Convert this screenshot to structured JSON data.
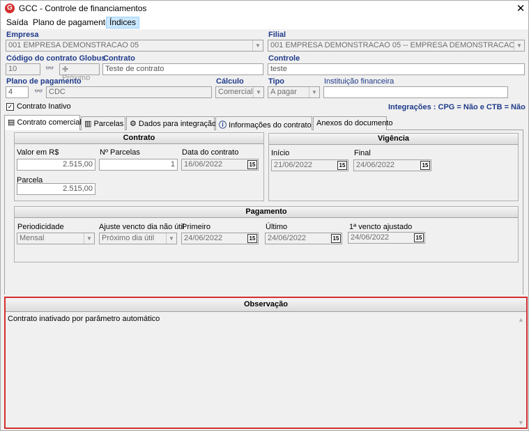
{
  "window": {
    "title": "GCC - Controle de financiamentos",
    "app_icon_letter": "G"
  },
  "menu": [
    {
      "label": "Saída"
    },
    {
      "label": "Plano de pagamento"
    },
    {
      "label": "Índices"
    }
  ],
  "form": {
    "empresa_label": "Empresa",
    "empresa_value": "001 EMPRESA DEMONSTRACAO 05",
    "filial_label": "Filial",
    "filial_value": "001 EMPRESA DEMONSTRACAO 05 -- EMPRESA DEMONSTRACAO 05",
    "codigo_label": "Código do contrato Globus",
    "codigo_value": "10",
    "proximo_label": "Próximo",
    "contrato_label": "Contrato",
    "contrato_value": "Teste de contrato",
    "controle_label": "Controle",
    "controle_value": "teste",
    "plano_label": "Plano de pagamento",
    "plano_code": "4",
    "plano_value": "CDC",
    "calculo_label": "Cálculo",
    "calculo_value": "Comercial",
    "tipo_label": "Tipo",
    "tipo_value": "A pagar",
    "instituicao_label": "Instituição financeira",
    "instituicao_value": "",
    "inativo_label": "Contrato Inativo",
    "inativo_checked": "✓",
    "integracoes": "Integrações : CPG = Não e CTB = Não"
  },
  "tabs": [
    {
      "label": "Contrato comercial"
    },
    {
      "label": "Parcelas"
    },
    {
      "label": "Dados para integração"
    },
    {
      "label": "Informações do contrato"
    },
    {
      "label": "Anexos do documento"
    }
  ],
  "contrato_panel": {
    "title": "Contrato",
    "valor_label": "Valor em R$",
    "valor_value": "2.515,00",
    "nparcelas_label": "Nº Parcelas",
    "nparcelas_value": "1",
    "data_label": "Data do contrato",
    "data_value": "16/06/2022",
    "parcela_label": "Parcela",
    "parcela_value": "2.515,00"
  },
  "vigencia_panel": {
    "title": "Vigência",
    "inicio_label": "Início",
    "inicio_value": "21/06/2022",
    "final_label": "Final",
    "final_value": "24/06/2022"
  },
  "pagamento_panel": {
    "title": "Pagamento",
    "periodicidade_label": "Periodicidade",
    "periodicidade_value": "Mensal",
    "ajuste_label": "Ajuste vencto dia não útil",
    "ajuste_value": "Próximo dia útil",
    "primeiro_label": "Primeiro",
    "primeiro_value": "24/06/2022",
    "ultimo_label": "Último",
    "ultimo_value": "24/06/2022",
    "ajustado_label": "1ª vencto ajustado",
    "ajustado_value": "24/06/2022"
  },
  "observacao": {
    "title": "Observação",
    "text": "Contrato inativado por parâmetro automático"
  },
  "calendar_icon_text": "15",
  "colors": {
    "label_blue": "#1e3a8a",
    "highlight_red": "#d32f2f",
    "menu_active": "#cce8ff"
  }
}
